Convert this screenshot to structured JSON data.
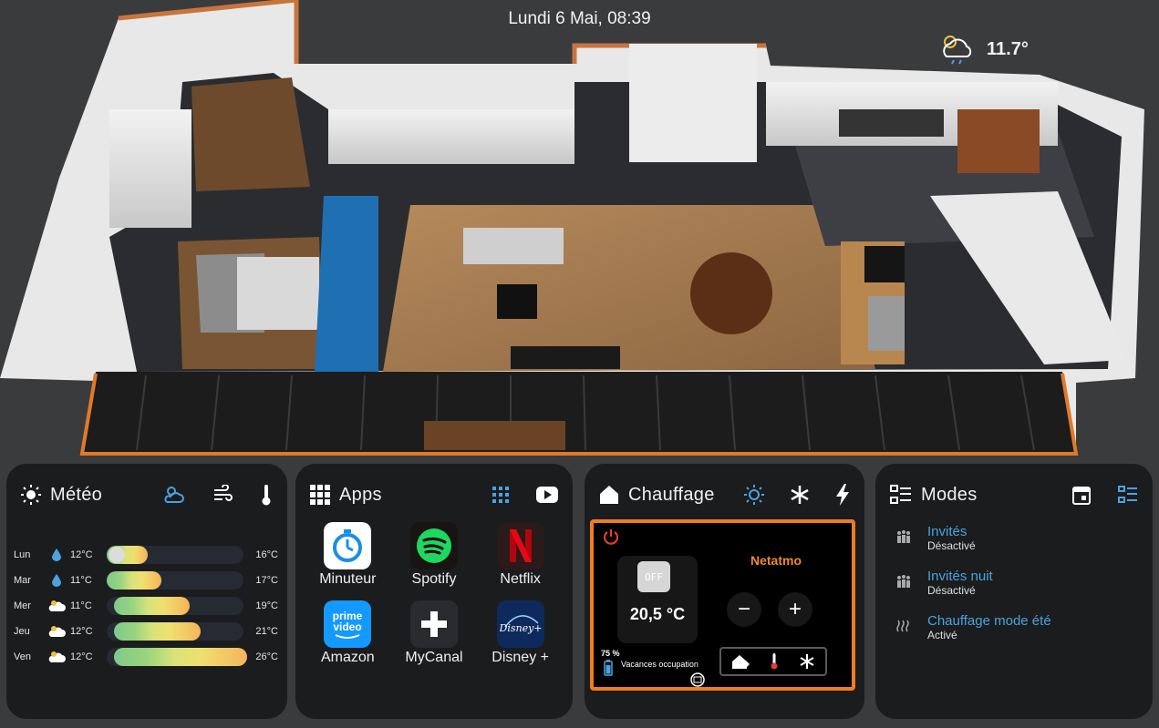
{
  "header": {
    "datetime": "Lundi 6 Mai, 08:39",
    "current_temp": "11.7°",
    "current_weather_icon": "cloud-rain-sun-icon"
  },
  "meteo": {
    "title": "Météo",
    "header_icons": [
      "sun-icon",
      "weather-partly-cloudy-icon",
      "wind-icon",
      "thermometer-icon"
    ],
    "forecast": [
      {
        "day": "Lun",
        "icon": "raindrop-icon",
        "tmin": "12°C",
        "tmax": "16°C",
        "fill": 0.3
      },
      {
        "day": "Mar",
        "icon": "raindrop-icon",
        "tmin": "11°C",
        "tmax": "17°C",
        "fill": 0.4
      },
      {
        "day": "Mer",
        "icon": "cloud-icon",
        "tmin": "11°C",
        "tmax": "19°C",
        "fill": 0.55
      },
      {
        "day": "Jeu",
        "icon": "cloud-icon",
        "tmin": "12°C",
        "tmax": "21°C",
        "fill": 0.63
      },
      {
        "day": "Ven",
        "icon": "cloud-icon",
        "tmin": "12°C",
        "tmax": "26°C",
        "fill": 0.97
      }
    ]
  },
  "apps": {
    "title": "Apps",
    "items": [
      {
        "label": "Minuteur",
        "icon": "stopwatch-icon"
      },
      {
        "label": "Spotify",
        "icon": "spotify-icon"
      },
      {
        "label": "Netflix",
        "icon": "netflix-icon"
      },
      {
        "label": "Amazon",
        "icon": "prime-video-icon",
        "logo_text": "prime video"
      },
      {
        "label": "MyCanal",
        "icon": "plus-icon"
      },
      {
        "label": "Disney +",
        "icon": "disney-plus-icon",
        "logo_text": "Disney+"
      }
    ]
  },
  "chauffage": {
    "title": "Chauffage",
    "brand": "Netatmo",
    "off_label": "OFF",
    "setpoint": "20,5 °C",
    "battery": "75 %",
    "status": "Vacances occupation",
    "minus": "−",
    "plus": "+"
  },
  "modes": {
    "title": "Modes",
    "items": [
      {
        "name": "Invités",
        "state": "Désactivé"
      },
      {
        "name": "Invités nuit",
        "state": "Désactivé"
      },
      {
        "name": "Chauffage mode été",
        "state": "Activé"
      }
    ]
  },
  "colors": {
    "accent_orange": "#f07c22",
    "link_blue": "#4aa3df",
    "card_bg": "#1b1c1e",
    "page_bg": "#3a3b3d"
  }
}
